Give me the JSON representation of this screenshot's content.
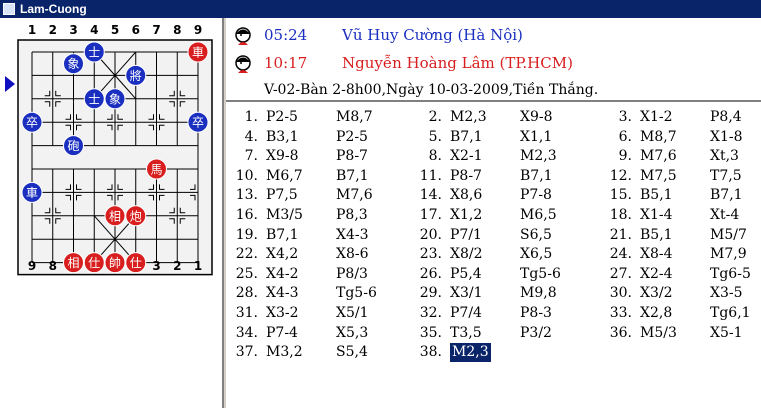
{
  "window": {
    "title": "Lam-Cuong"
  },
  "board": {
    "top_files": [
      "1",
      "2",
      "3",
      "4",
      "5",
      "6",
      "7",
      "8",
      "9"
    ],
    "bottom_files": [
      "9",
      "8",
      "7",
      "6",
      "5",
      "4",
      "3",
      "2",
      "1"
    ],
    "colors": {
      "red": "#d81e1e",
      "blue": "#1a2fc0",
      "board_bg": "#f2f2f2",
      "line": "#000000"
    },
    "pieces": [
      {
        "side": "blue",
        "glyph": "象",
        "col": 2,
        "row": 0.5
      },
      {
        "side": "blue",
        "glyph": "士",
        "col": 3,
        "row": 0
      },
      {
        "side": "red",
        "glyph": "車",
        "col": 8,
        "row": 0
      },
      {
        "side": "blue",
        "glyph": "將",
        "col": 5,
        "row": 1
      },
      {
        "side": "blue",
        "glyph": "士",
        "col": 3,
        "row": 2
      },
      {
        "side": "blue",
        "glyph": "象",
        "col": 4,
        "row": 2
      },
      {
        "side": "blue",
        "glyph": "卒",
        "col": 0,
        "row": 3
      },
      {
        "side": "blue",
        "glyph": "卒",
        "col": 8,
        "row": 3
      },
      {
        "side": "blue",
        "glyph": "砲",
        "col": 2,
        "row": 4
      },
      {
        "side": "red",
        "glyph": "馬",
        "col": 6,
        "row": 5
      },
      {
        "side": "blue",
        "glyph": "車",
        "col": 0,
        "row": 6
      },
      {
        "side": "red",
        "glyph": "相",
        "col": 4,
        "row": 7
      },
      {
        "side": "red",
        "glyph": "炮",
        "col": 5,
        "row": 7
      },
      {
        "side": "red",
        "glyph": "相",
        "col": 2,
        "row": 9
      },
      {
        "side": "red",
        "glyph": "仕",
        "col": 3,
        "row": 9
      },
      {
        "side": "red",
        "glyph": "帥",
        "col": 4,
        "row": 9
      },
      {
        "side": "red",
        "glyph": "仕",
        "col": 5,
        "row": 9
      }
    ]
  },
  "players": [
    {
      "time": "05:24",
      "name": "Vũ Huy Cường (Hà Nội)",
      "color": "#1a2fc0"
    },
    {
      "time": "10:17",
      "name": "Nguyễn Hoàng Lâm (TP.HCM)",
      "color": "#d81e1e"
    }
  ],
  "event": "V-02-Bàn 2-8h00,Ngày 10-03-2009,Tiền Thắng.",
  "moves": [
    {
      "n": "1.",
      "r": "P2-5",
      "b": "M8,7"
    },
    {
      "n": "2.",
      "r": "M2,3",
      "b": "X9-8"
    },
    {
      "n": "3.",
      "r": "X1-2",
      "b": "P8,4"
    },
    {
      "n": "4.",
      "r": "B3,1",
      "b": "P2-5"
    },
    {
      "n": "5.",
      "r": "B7,1",
      "b": "X1,1"
    },
    {
      "n": "6.",
      "r": "M8,7",
      "b": "X1-8"
    },
    {
      "n": "7.",
      "r": "X9-8",
      "b": "P8-7"
    },
    {
      "n": "8.",
      "r": "X2-1",
      "b": "M2,3"
    },
    {
      "n": "9.",
      "r": "M7,6",
      "b": "Xt,3"
    },
    {
      "n": "10.",
      "r": "M6,7",
      "b": "B7,1"
    },
    {
      "n": "11.",
      "r": "P8-7",
      "b": "B7,1"
    },
    {
      "n": "12.",
      "r": "M7,5",
      "b": "T7,5"
    },
    {
      "n": "13.",
      "r": "P7,5",
      "b": "M7,6"
    },
    {
      "n": "14.",
      "r": "X8,6",
      "b": "P7-8"
    },
    {
      "n": "15.",
      "r": "B5,1",
      "b": "B7,1"
    },
    {
      "n": "16.",
      "r": "M3/5",
      "b": "P8,3"
    },
    {
      "n": "17.",
      "r": "X1,2",
      "b": "M6,5"
    },
    {
      "n": "18.",
      "r": "X1-4",
      "b": "Xt-4"
    },
    {
      "n": "19.",
      "r": "B7,1",
      "b": "X4-3"
    },
    {
      "n": "20.",
      "r": "P7/1",
      "b": "S6,5"
    },
    {
      "n": "21.",
      "r": "B5,1",
      "b": "M5/7"
    },
    {
      "n": "22.",
      "r": "X4,2",
      "b": "X8-6"
    },
    {
      "n": "23.",
      "r": "X8/2",
      "b": "X6,5"
    },
    {
      "n": "24.",
      "r": "X8-4",
      "b": "M7,9"
    },
    {
      "n": "25.",
      "r": "X4-2",
      "b": "P8/3"
    },
    {
      "n": "26.",
      "r": "P5,4",
      "b": "Tg5-6"
    },
    {
      "n": "27.",
      "r": "X2-4",
      "b": "Tg6-5"
    },
    {
      "n": "28.",
      "r": "X4-3",
      "b": "Tg5-6"
    },
    {
      "n": "29.",
      "r": "X3/1",
      "b": "M9,8"
    },
    {
      "n": "30.",
      "r": "X3/2",
      "b": "X3-5"
    },
    {
      "n": "31.",
      "r": "X3-2",
      "b": "X5/1"
    },
    {
      "n": "32.",
      "r": "P7/4",
      "b": "P8-3"
    },
    {
      "n": "33.",
      "r": "X2,8",
      "b": "Tg6,1"
    },
    {
      "n": "34.",
      "r": "P7-4",
      "b": "X5,3"
    },
    {
      "n": "35.",
      "r": "T3,5",
      "b": "P3/2"
    },
    {
      "n": "36.",
      "r": "M5/3",
      "b": "X5-1"
    },
    {
      "n": "37.",
      "r": "M3,2",
      "b": "S5,4"
    },
    {
      "n": "38.",
      "r": "M2,3",
      "b": ""
    }
  ],
  "selected_move": "38"
}
